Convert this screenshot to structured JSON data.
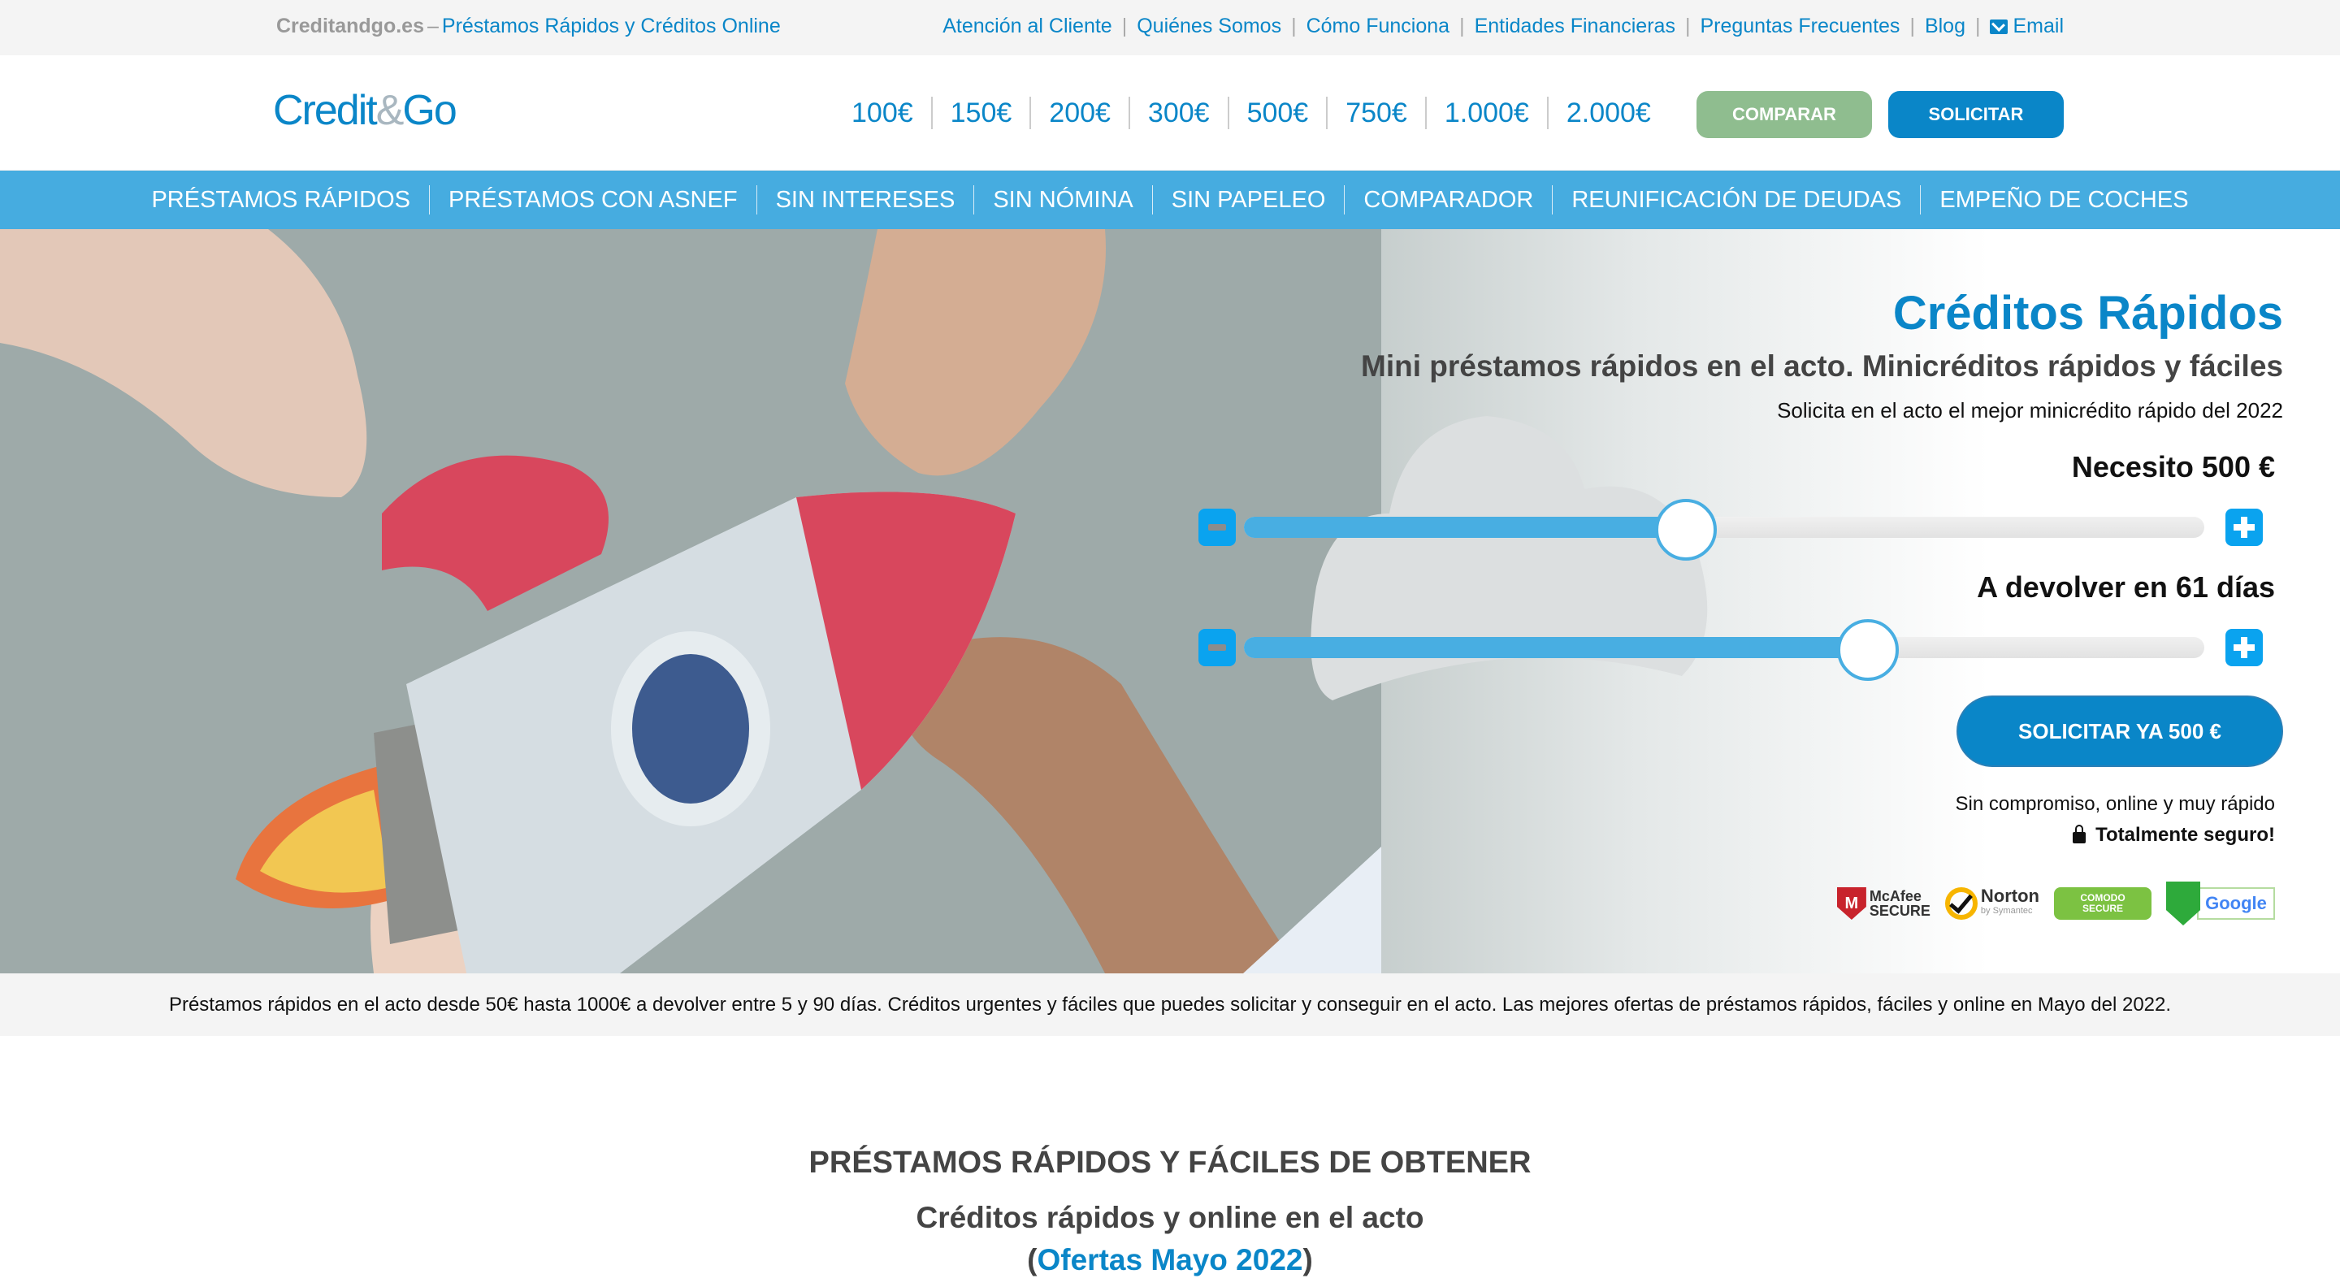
{
  "topbar": {
    "site": "Creditandgo.es",
    "separator": "–",
    "tagline": "Préstamos Rápidos y Créditos Online",
    "links": [
      "Atención al Cliente",
      "Quiénes Somos",
      "Cómo Funciona",
      "Entidades Financieras",
      "Preguntas Frecuentes",
      "Blog"
    ],
    "email_label": "Email"
  },
  "header": {
    "logo_part1": "Credit",
    "logo_amp": "&",
    "logo_part2": "Go",
    "amounts": [
      "100€",
      "150€",
      "200€",
      "300€",
      "500€",
      "750€",
      "1.000€",
      "2.000€"
    ],
    "compare_label": "COMPARAR",
    "solicitar_label": "SOLICITAR"
  },
  "nav": {
    "items": [
      "PRÉSTAMOS RÁPIDOS",
      "PRÉSTAMOS CON ASNEF",
      "SIN INTERESES",
      "SIN NÓMINA",
      "SIN PAPELEO",
      "COMPARADOR",
      "REUNIFICACIÓN DE DEUDAS",
      "EMPEÑO DE COCHES"
    ]
  },
  "hero": {
    "title": "Créditos Rápidos",
    "subtitle": "Mini préstamos rápidos en el acto. Minicréditos rápidos y fáciles",
    "subtitle2": "Solicita en el acto el mejor minicrédito rápido del 2022",
    "amount_slider": {
      "label": "Necesito 500 €",
      "fill_fraction": 0.46
    },
    "days_slider": {
      "label": "A devolver en 61 días",
      "fill_fraction": 0.65
    },
    "cta_label": "SOLICITAR YA 500 €",
    "note1": "Sin compromiso, online y muy rápido",
    "note2": "Totalmente seguro!",
    "badges": {
      "mcafee_top": "McAfee",
      "mcafee_bottom": "SECURE",
      "mcafee_letter": "M",
      "norton_top": "Norton",
      "norton_bottom": "by Symantec",
      "comodo_top": "COMODO",
      "comodo_bottom": "SECURE",
      "google": "Google"
    }
  },
  "strip": {
    "text": "Préstamos rápidos en el acto desde 50€ hasta 1000€ a devolver entre 5 y 90 días. Créditos urgentes y fáciles que puedes solicitar y conseguir en el acto. Las mejores ofertas de préstamos rápidos, fáciles y online en Mayo del 2022."
  },
  "section": {
    "heading": "PRÉSTAMOS RÁPIDOS Y FÁCILES DE OBTENER",
    "subheading": "Créditos rápidos y online en el acto",
    "offers_open": "(",
    "offers_link": "Ofertas Mayo 2022",
    "offers_close": ")"
  }
}
